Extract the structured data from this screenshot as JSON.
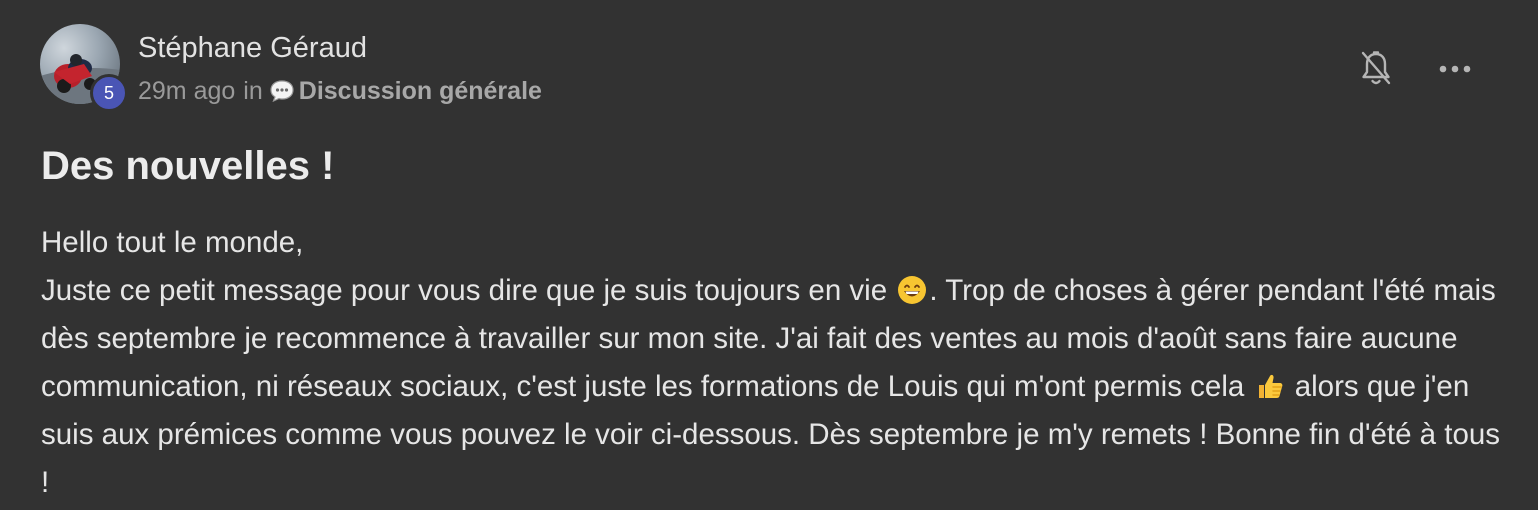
{
  "author": {
    "name": "Stéphane Géraud",
    "level": "5"
  },
  "meta": {
    "time": "29m ago",
    "in_word": "in",
    "category": "Discussion générale",
    "category_icon": "speech-bubble-icon"
  },
  "actions": {
    "bell_icon": "bell-off-icon",
    "more_icon": "more-horizontal-icon"
  },
  "post": {
    "title": "Des nouvelles !",
    "greeting": "Hello tout le monde,",
    "part1": "Juste ce petit message pour vous dire que je suis toujours en vie",
    "emoji1": "grinning-face-emoji",
    "part2": ". Trop de choses à gérer pendant l'été mais dès septembre je recommence à travailler sur mon site. J'ai fait des ventes au mois d'août sans faire aucune communication, ni réseaux sociaux, c'est juste les formations de Louis qui m'ont permis cela",
    "emoji2": "thumbs-up-emoji",
    "part3": " alors que j'en suis aux prémices comme vous pouvez le voir ci-dessous. Dès septembre je m'y remets ! Bonne fin d'été à tous !"
  },
  "colors": {
    "background": "#323232",
    "badge": "#4a55b5",
    "text": "#e6e6e6",
    "muted": "#9a9a9a"
  }
}
